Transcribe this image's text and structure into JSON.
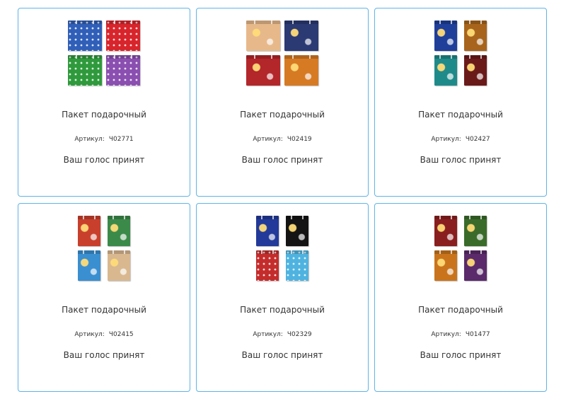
{
  "products": [
    {
      "title": "Пакет подарочный",
      "article_label": "Артикул:",
      "article": "Ч02771",
      "vote_status": "Ваш голос принят",
      "image_layout": "landscape",
      "bag_colors": [
        "#2f5fb8",
        "#d8242b",
        "#2f9a3c",
        "#8a4fb0"
      ]
    },
    {
      "title": "Пакет подарочный",
      "article_label": "Артикул:",
      "article": "Ч02419",
      "vote_status": "Ваш голос принят",
      "image_layout": "landscape",
      "bag_colors": [
        "#e7b98a",
        "#2b3a73",
        "#b3262a",
        "#d67a24"
      ]
    },
    {
      "title": "Пакет подарочный",
      "article_label": "Артикул:",
      "article": "Ч02427",
      "vote_status": "Ваш голос принят",
      "image_layout": "portrait",
      "bag_colors": [
        "#1f3f9a",
        "#a8641c",
        "#1f8a8a",
        "#6b1a1a"
      ]
    },
    {
      "title": "Пакет подарочный",
      "article_label": "Артикул:",
      "article": "Ч02415",
      "vote_status": "Ваш голос принят",
      "image_layout": "portrait",
      "bag_colors": [
        "#c8402c",
        "#3c8a4a",
        "#3a8fd0",
        "#d9b890"
      ]
    },
    {
      "title": "Пакет подарочный",
      "article_label": "Артикул:",
      "article": "Ч02329",
      "vote_status": "Ваш голос принят",
      "image_layout": "portrait",
      "bag_colors": [
        "#233a9a",
        "#141414",
        "#c42c2c",
        "#4fb3e0"
      ]
    },
    {
      "title": "Пакет подарочный",
      "article_label": "Артикул:",
      "article": "Ч01477",
      "vote_status": "Ваш голос принят",
      "image_layout": "portrait",
      "bag_colors": [
        "#8a1f1f",
        "#3a6b2a",
        "#c9741c",
        "#5a2a6a"
      ]
    }
  ],
  "colors": {
    "card_border": "#5fb4e6",
    "text": "#333333",
    "background": "#ffffff"
  }
}
